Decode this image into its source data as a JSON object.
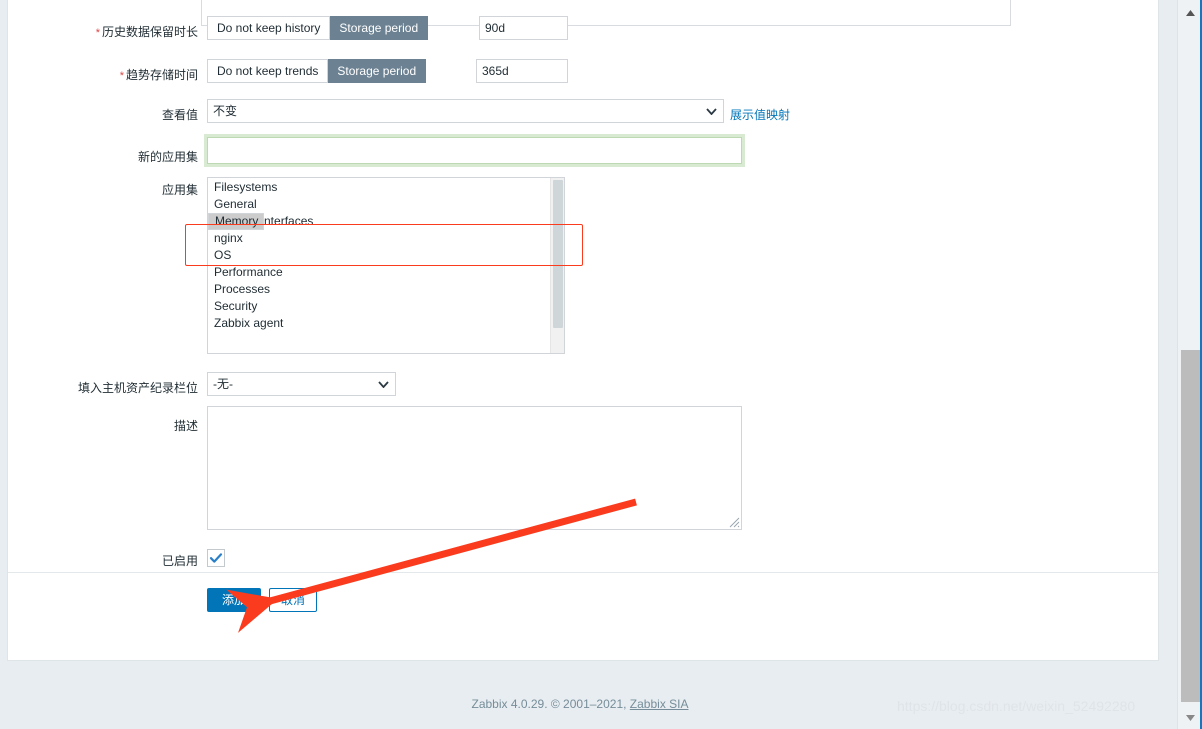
{
  "meta": {
    "product": "Zabbix",
    "accent_blue": "#0275b8",
    "selected_toggle_bg": "#6c8293",
    "annotation_red": "#fb3b1e",
    "focus_green": "#bcd9b4"
  },
  "form": {
    "history": {
      "label": "历史数据保留时长",
      "required": true,
      "options": [
        "Do not keep history",
        "Storage period"
      ],
      "selected": "Storage period",
      "value": "90d"
    },
    "trends": {
      "label": "趋势存储时间",
      "required": true,
      "options": [
        "Do not keep trends",
        "Storage period"
      ],
      "selected": "Storage period",
      "value": "365d"
    },
    "value_type": {
      "label": "查看值",
      "selected": "不变",
      "options": [
        "不变"
      ],
      "link_label": "展示值映射",
      "chevron_icon": "chevron-down-icon"
    },
    "new_application": {
      "label": "新的应用集",
      "value": "",
      "placeholder": "",
      "focused": true
    },
    "applications": {
      "label": "应用集",
      "items": [
        "Filesystems",
        "General",
        "Memory",
        "Network interfaces",
        "nginx",
        "OS",
        "Performance",
        "Processes",
        "Security",
        "Zabbix agent"
      ],
      "selected": [
        "Memory"
      ]
    },
    "inventory_field": {
      "label": "填入主机资产纪录栏位",
      "selected": "-无-",
      "options": [
        "-无-"
      ],
      "chevron_icon": "chevron-down-icon"
    },
    "description": {
      "label": "描述",
      "value": "",
      "placeholder": "",
      "resize_handle_icon": "resize-grip-icon"
    },
    "enabled": {
      "label": "已启用",
      "checked": true,
      "check_icon": "checkmark-icon"
    }
  },
  "actions": {
    "submit_label": "添加",
    "cancel_label": "取消"
  },
  "footer": {
    "text": "Zabbix 4.0.29. © 2001–2021, ",
    "link_label": "Zabbix SIA"
  },
  "watermark": {
    "text": "https://blog.csdn.net/weixin_52492280"
  },
  "scrollbar": {
    "up_icon": "triangle-up-icon",
    "down_icon": "triangle-down-icon",
    "thumb_name": "scrollbar-thumb"
  },
  "annotations": {
    "highlight_box_name": "red-highlight-rectangle",
    "arrow_name": "red-pointer-arrow"
  }
}
